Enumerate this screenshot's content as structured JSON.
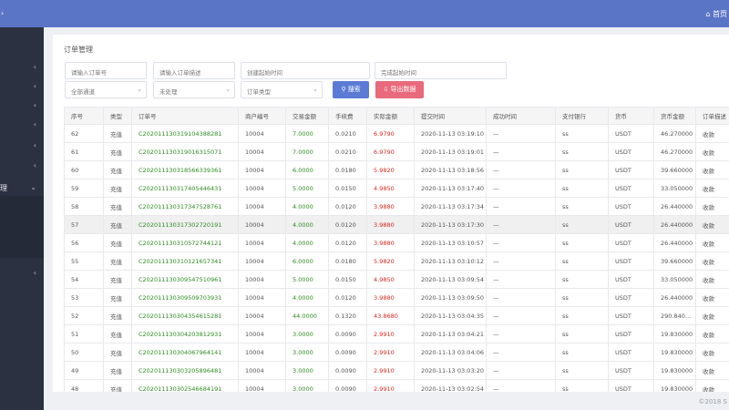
{
  "header": {
    "left_glyph": "›",
    "home_icon": "home-icon",
    "home_label": "首页"
  },
  "sidebar": {
    "active_label": "理",
    "items": [
      {
        "chev": "‹"
      },
      {
        "chev": "‹"
      },
      {
        "chev": "‹"
      },
      {
        "chev": "‹"
      },
      {
        "chev": "‹"
      },
      {
        "chev": "‹"
      },
      {
        "chev": "⌄"
      },
      {
        "chev": "‹"
      }
    ]
  },
  "page": {
    "title": "订单管理",
    "filters": {
      "order_no": "请输入订单号",
      "order_desc": "请输入订单描述",
      "create_time": "创建起始时间",
      "finish_time": "完成起始时间",
      "channel": "全部通道",
      "status": "未处理",
      "order_type": "订单类型"
    },
    "buttons": {
      "search": "搜索",
      "export": "导出数据"
    },
    "columns": [
      "序号",
      "类型",
      "订单号",
      "商户编号",
      "交易金额",
      "手续费",
      "实际金额",
      "提交时间",
      "成功时间",
      "支付银行",
      "货币",
      "货币金额",
      "订单描述"
    ],
    "rows": [
      {
        "no": "62",
        "type": "充值",
        "order": "C202011130319104388281",
        "merchant": "10004",
        "amount": "7.0000",
        "fee": "0.0210",
        "actual": "6.9790",
        "submit": "2020-11-13 03:19:10",
        "success": "—",
        "bank": "ss",
        "cur": "USDT",
        "cur_amount": "46.270000",
        "desc": "收款"
      },
      {
        "no": "61",
        "type": "充值",
        "order": "C202011130319016315071",
        "merchant": "10004",
        "amount": "7.0000",
        "fee": "0.0210",
        "actual": "6.9790",
        "submit": "2020-11-13 03:19:01",
        "success": "—",
        "bank": "ss",
        "cur": "USDT",
        "cur_amount": "46.270000",
        "desc": "收款"
      },
      {
        "no": "60",
        "type": "充值",
        "order": "C202011130318566339361",
        "merchant": "10004",
        "amount": "6.0000",
        "fee": "0.0180",
        "actual": "5.9820",
        "submit": "2020-11-13 03:18:56",
        "success": "—",
        "bank": "ss",
        "cur": "USDT",
        "cur_amount": "39.660000",
        "desc": "收款"
      },
      {
        "no": "59",
        "type": "充值",
        "order": "C202011130317405446431",
        "merchant": "10004",
        "amount": "5.0000",
        "fee": "0.0150",
        "actual": "4.9850",
        "submit": "2020-11-13 03:17:40",
        "success": "—",
        "bank": "ss",
        "cur": "USDT",
        "cur_amount": "33.050000",
        "desc": "收款"
      },
      {
        "no": "58",
        "type": "充值",
        "order": "C202011130317347528761",
        "merchant": "10004",
        "amount": "4.0000",
        "fee": "0.0120",
        "actual": "3.9880",
        "submit": "2020-11-13 03:17:34",
        "success": "—",
        "bank": "ss",
        "cur": "USDT",
        "cur_amount": "26.440000",
        "desc": "收款"
      },
      {
        "no": "57",
        "type": "充值",
        "order": "C202011130317302720191",
        "merchant": "10004",
        "amount": "4.0000",
        "fee": "0.0120",
        "actual": "3.9880",
        "submit": "2020-11-13 03:17:30",
        "success": "—",
        "bank": "ss",
        "cur": "USDT",
        "cur_amount": "26.440000",
        "desc": "收款"
      },
      {
        "no": "56",
        "type": "充值",
        "order": "C202011130310572744121",
        "merchant": "10004",
        "amount": "4.0000",
        "fee": "0.0120",
        "actual": "3.9880",
        "submit": "2020-11-13 03:10:57",
        "success": "—",
        "bank": "ss",
        "cur": "USDT",
        "cur_amount": "26.440000",
        "desc": "收款"
      },
      {
        "no": "55",
        "type": "充值",
        "order": "C202011130310121657341",
        "merchant": "10004",
        "amount": "6.0000",
        "fee": "0.0180",
        "actual": "5.9820",
        "submit": "2020-11-13 03:10:12",
        "success": "—",
        "bank": "ss",
        "cur": "USDT",
        "cur_amount": "39.660000",
        "desc": "收款"
      },
      {
        "no": "54",
        "type": "充值",
        "order": "C202011130309547510961",
        "merchant": "10004",
        "amount": "5.0000",
        "fee": "0.0150",
        "actual": "4.9850",
        "submit": "2020-11-13 03:09:54",
        "success": "—",
        "bank": "ss",
        "cur": "USDT",
        "cur_amount": "33.050000",
        "desc": "收款"
      },
      {
        "no": "53",
        "type": "充值",
        "order": "C202011130309509703931",
        "merchant": "10004",
        "amount": "4.0000",
        "fee": "0.0120",
        "actual": "3.9880",
        "submit": "2020-11-13 03:09:50",
        "success": "—",
        "bank": "ss",
        "cur": "USDT",
        "cur_amount": "26.440000",
        "desc": "收款"
      },
      {
        "no": "52",
        "type": "充值",
        "order": "C202011130304354615281",
        "merchant": "10004",
        "amount": "44.0000",
        "fee": "0.1320",
        "actual": "43.8680",
        "submit": "2020-11-13 03:04:35",
        "success": "—",
        "bank": "ss",
        "cur": "USDT",
        "cur_amount": "290.840…",
        "desc": "收款"
      },
      {
        "no": "51",
        "type": "充值",
        "order": "C202011130304203812931",
        "merchant": "10004",
        "amount": "3.0000",
        "fee": "0.0090",
        "actual": "2.9910",
        "submit": "2020-11-13 03:04:21",
        "success": "—",
        "bank": "ss",
        "cur": "USDT",
        "cur_amount": "19.830000",
        "desc": "收款"
      },
      {
        "no": "50",
        "type": "充值",
        "order": "C202011130304067964141",
        "merchant": "10004",
        "amount": "3.0000",
        "fee": "0.0090",
        "actual": "2.9910",
        "submit": "2020-11-13 03:04:06",
        "success": "—",
        "bank": "ss",
        "cur": "USDT",
        "cur_amount": "19.830000",
        "desc": "收款"
      },
      {
        "no": "49",
        "type": "充值",
        "order": "C202011130303205896481",
        "merchant": "10004",
        "amount": "3.0000",
        "fee": "0.0090",
        "actual": "2.9910",
        "submit": "2020-11-13 03:03:20",
        "success": "—",
        "bank": "ss",
        "cur": "USDT",
        "cur_amount": "19.830000",
        "desc": "收款"
      },
      {
        "no": "48",
        "type": "充值",
        "order": "C202011130302546684191",
        "merchant": "10004",
        "amount": "3.0000",
        "fee": "0.0090",
        "actual": "2.9910",
        "submit": "2020-11-13 03:02:54",
        "success": "—",
        "bank": "ss",
        "cur": "USDT",
        "cur_amount": "19.830000",
        "desc": "收款"
      }
    ],
    "highlighted_row": 5
  },
  "footer": {
    "copyright": "©2018 S"
  }
}
